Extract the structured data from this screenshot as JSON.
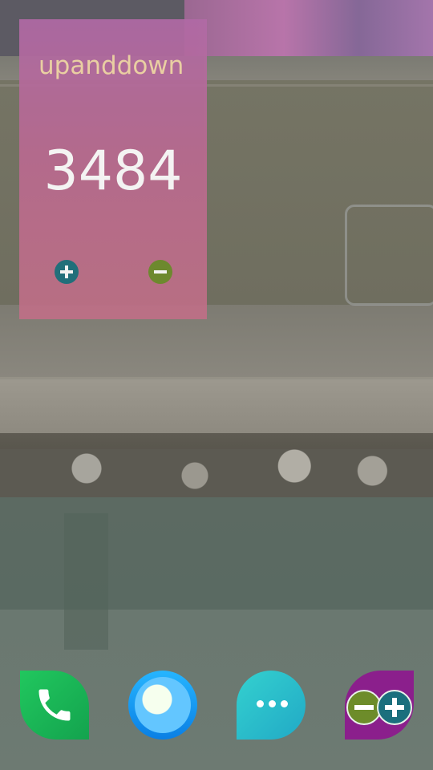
{
  "widget": {
    "title": "upanddown",
    "count": "3484",
    "increment_icon": "plus-icon",
    "decrement_icon": "minus-icon",
    "background_color": "#b96a90"
  },
  "dock": {
    "apps": [
      {
        "name": "phone",
        "icon": "phone-icon"
      },
      {
        "name": "browser",
        "icon": "globe-icon"
      },
      {
        "name": "messages",
        "icon": "chat-bubble-icon"
      },
      {
        "name": "upanddown",
        "icon": "plus-minus-icon"
      }
    ]
  }
}
